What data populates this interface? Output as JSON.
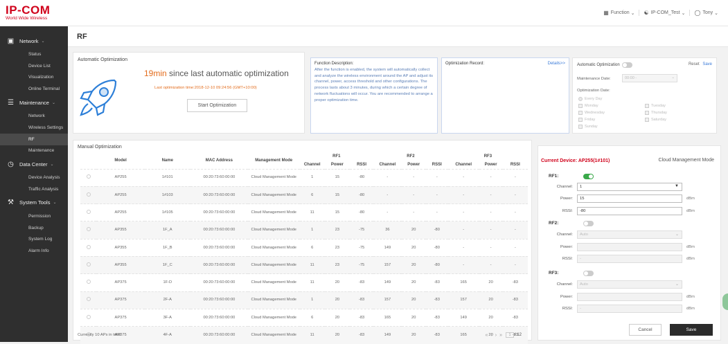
{
  "brand": {
    "logo": "IP-COM",
    "tagline": "World Wide Wireless"
  },
  "topnav": {
    "function": "Function",
    "network": "IP-COM_Test",
    "user": "Tony"
  },
  "sidebar": {
    "network": "Network",
    "network_items": [
      "Status",
      "Device List",
      "Visualization",
      "Online Terminal"
    ],
    "maintenance": "Maintenance",
    "maintenance_items": [
      "Network",
      "Wireless Settings",
      "RF",
      "Maintenance"
    ],
    "data_center": "Data Center",
    "data_center_items": [
      "Device Analysis",
      "Traffic Analysis"
    ],
    "system_tools": "System Tools",
    "system_tools_items": [
      "Permission",
      "Backup",
      "System Log",
      "Alarm Info"
    ]
  },
  "page": {
    "title": "RF"
  },
  "auto": {
    "label": "Automatic Optimization",
    "minutes": "19min",
    "since": " since last automatic optimization",
    "last_time": "Last optimization time:2018-12-10 09:24:56 (GMT+10:00)",
    "start_button": "Start Optimization"
  },
  "func": {
    "title": "Function Description:",
    "text": "After the function is enabled, the system will automatically collect and analyze the wireless environment around the AP and adjust its channel, power, access threshold and other configurations. The process lasts about 3 minutes, during which a certain degree of network fluctuations will occur. You are recommended to arrange a proper optimization time."
  },
  "record": {
    "title": "Optimization Record:",
    "details": "Details>>"
  },
  "settings": {
    "auto_opt": "Automatic Optimization",
    "reset": "Reset",
    "save": "Save",
    "maint_date": "Maintenance Date:",
    "maint_value": "00:00 -",
    "opt_date": "Optimization Date:",
    "days": [
      "Every Day",
      "Monday",
      "Tuesday",
      "Wednesday",
      "Thursday",
      "Friday",
      "Saturday",
      "Sunday"
    ]
  },
  "manual": {
    "label": "Manual Optimization",
    "headers": {
      "model": "Model",
      "name": "Name",
      "mac": "MAC Address",
      "mode": "Management Mode",
      "rf1": "RF1",
      "rf2": "RF2",
      "rf3": "RF3",
      "channel": "Channel",
      "power": "Power",
      "rssi": "RSSI"
    },
    "rows": [
      {
        "model": "AP255",
        "name": "1#101",
        "mac": "00:20:73:60:00:00",
        "mode": "Cloud Management Mode",
        "rf1": [
          "1",
          "15",
          "-80"
        ],
        "rf2": [
          "-",
          "-",
          "-"
        ],
        "rf3": [
          "-",
          "-",
          "-"
        ]
      },
      {
        "model": "AP255",
        "name": "1#103",
        "mac": "00:20:73:60:00:00",
        "mode": "Cloud Management Mode",
        "rf1": [
          "6",
          "15",
          "-80"
        ],
        "rf2": [
          "-",
          "-",
          "-"
        ],
        "rf3": [
          "-",
          "-",
          "-"
        ]
      },
      {
        "model": "AP255",
        "name": "1#105",
        "mac": "00:20:73:60:00:00",
        "mode": "Cloud Management Mode",
        "rf1": [
          "11",
          "15",
          "-80"
        ],
        "rf2": [
          "-",
          "-",
          "-"
        ],
        "rf3": [
          "-",
          "-",
          "-"
        ]
      },
      {
        "model": "AP355",
        "name": "1F_A",
        "mac": "00:20:73:60:00:00",
        "mode": "Cloud Management Mode",
        "rf1": [
          "1",
          "23",
          "-75"
        ],
        "rf2": [
          "36",
          "20",
          "-80"
        ],
        "rf3": [
          "-",
          "-",
          "-"
        ]
      },
      {
        "model": "AP355",
        "name": "1F_B",
        "mac": "00:20:73:60:00:00",
        "mode": "Cloud Management Mode",
        "rf1": [
          "6",
          "23",
          "-75"
        ],
        "rf2": [
          "149",
          "20",
          "-80"
        ],
        "rf3": [
          "-",
          "-",
          "-"
        ]
      },
      {
        "model": "AP355",
        "name": "1F_C",
        "mac": "00:20:73:60:00:00",
        "mode": "Cloud Management Mode",
        "rf1": [
          "11",
          "23",
          "-75"
        ],
        "rf2": [
          "157",
          "20",
          "-80"
        ],
        "rf3": [
          "-",
          "-",
          "-"
        ]
      },
      {
        "model": "AP375",
        "name": "1F-D",
        "mac": "00:20:73:60:00:00",
        "mode": "Cloud Management Mode",
        "rf1": [
          "11",
          "20",
          "-83"
        ],
        "rf2": [
          "149",
          "20",
          "-83"
        ],
        "rf3": [
          "165",
          "20",
          "-83"
        ]
      },
      {
        "model": "AP375",
        "name": "2F-A",
        "mac": "00:20:73:60:00:00",
        "mode": "Cloud Management Mode",
        "rf1": [
          "1",
          "20",
          "-83"
        ],
        "rf2": [
          "157",
          "20",
          "-83"
        ],
        "rf3": [
          "157",
          "20",
          "-83"
        ]
      },
      {
        "model": "AP375",
        "name": "3F-A",
        "mac": "00:20:73:60:00:00",
        "mode": "Cloud Management Mode",
        "rf1": [
          "6",
          "20",
          "-83"
        ],
        "rf2": [
          "165",
          "20",
          "-83"
        ],
        "rf3": [
          "149",
          "20",
          "-83"
        ]
      },
      {
        "model": "AP375",
        "name": "4F-A",
        "mac": "00:20:73:60:00:00",
        "mode": "Cloud Management Mode",
        "rf1": [
          "11",
          "20",
          "-83"
        ],
        "rf2": [
          "149",
          "20",
          "-83"
        ],
        "rf3": [
          "165",
          "20",
          "-83"
        ]
      }
    ],
    "footer": "Currently 10 APs in total",
    "page_input": "1",
    "total_pages": "/ 12"
  },
  "detail": {
    "current": "Current Device:  AP255(1#101)",
    "mode": "Cloud Management Mode",
    "rf1": "RF1:",
    "rf2": "RF2:",
    "rf3": "RF3:",
    "channel_label": "Channel:",
    "power_label": "Power:",
    "rssi_label": "RSSI:",
    "rf1_channel": "1",
    "rf1_power": "15",
    "rf1_rssi": "-80",
    "rf2_channel": "Auto",
    "rf2_power": "",
    "rf2_rssi": "-",
    "rf3_channel": "Auto",
    "rf3_power": "",
    "rf3_rssi": "-",
    "unit": "dBm",
    "cancel": "Cancel",
    "save": "Save"
  },
  "colors": {
    "brand": "#d0021b",
    "accent": "#e36c1c",
    "link": "#3a7ad8",
    "sidebar": "#2f2f2f",
    "toggle_on": "#3aa94a"
  }
}
